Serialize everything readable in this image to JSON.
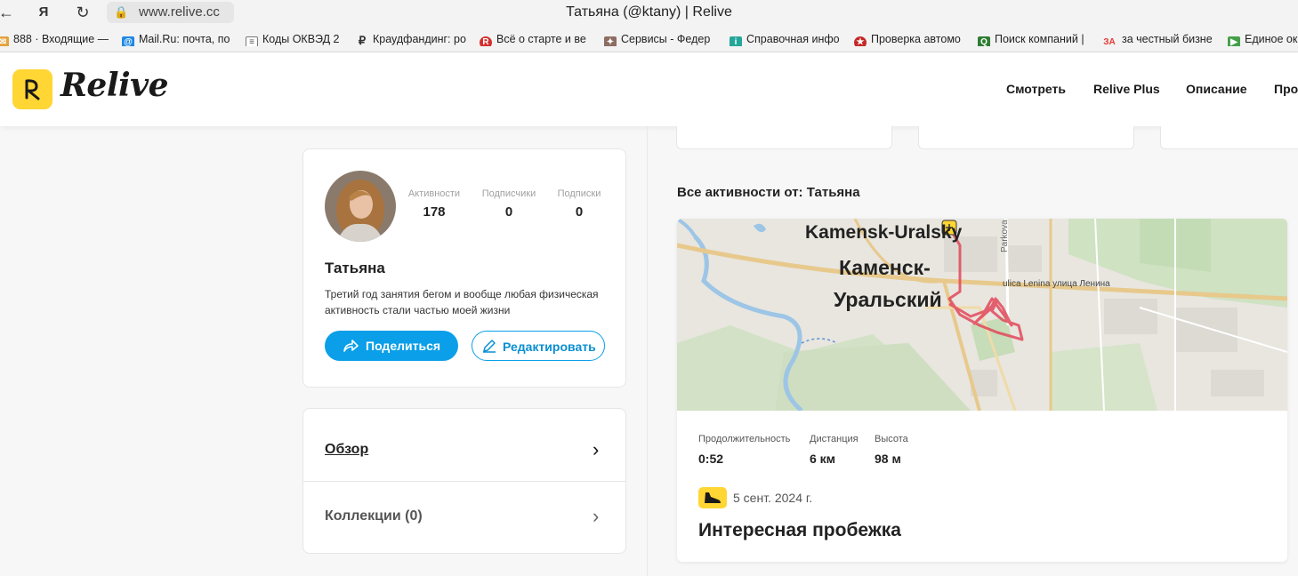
{
  "browser": {
    "url": "www.relive.cc",
    "window_title": "Татьяна (@ktany) | Relive",
    "nav_back": "←",
    "nav_yandex": "Я",
    "nav_reload": "↻",
    "bookmarks": [
      {
        "label": "888 · Входящие —",
        "icon_color": "#e6a23c"
      },
      {
        "label": "Mail.Ru: почта, по",
        "icon_color": "#1e88e5"
      },
      {
        "label": "Коды ОКВЭД 2",
        "icon_color": "#666666"
      },
      {
        "label": "Краудфандинг: ро",
        "icon_color": "#333333"
      },
      {
        "label": "Всё о старте и ве",
        "icon_color": "#d32f2f"
      },
      {
        "label": "Сервисы - Федер",
        "icon_color": "#8d6e63"
      },
      {
        "label": "Справочная инфо",
        "icon_color": "#26a69a"
      },
      {
        "label": "Проверка автомо",
        "icon_color": "#c62828"
      },
      {
        "label": "Поиск компаний |",
        "icon_color": "#2e7d32"
      },
      {
        "label": "за честный бизне",
        "icon_color": "#e53935",
        "icon_text": "ЗА"
      },
      {
        "label": "Единое ок",
        "icon_color": "#43a047"
      }
    ]
  },
  "header": {
    "logo_text": "Relive",
    "logo_glyph": "R",
    "nav": [
      "Смотреть",
      "Relive Plus",
      "Описание",
      "Про"
    ],
    "brand_color": "#ffd633"
  },
  "profile": {
    "stats": [
      {
        "label": "Активности",
        "value": "178"
      },
      {
        "label": "Подписчики",
        "value": "0"
      },
      {
        "label": "Подписки",
        "value": "0"
      }
    ],
    "name": "Татьяна",
    "bio": "Третий год занятия бегом и вообще любая физическая активность стали частью моей жизни",
    "share_label": "Поделиться",
    "edit_label": "Редактировать",
    "accent_color": "#0a9fe8"
  },
  "menu": [
    {
      "label": "Обзор",
      "underlined": true
    },
    {
      "label": "Коллекции (0)",
      "underlined": false
    }
  ],
  "activities": {
    "section_title": "Все активности от: Татьяна",
    "map_labels": {
      "city_latin": "Kamensk-Uralsky",
      "city_ru_line1": "Каменск-",
      "city_ru_line2": "Уральский",
      "street": "ulica Lenina улица Ленина",
      "park": "Parkova"
    },
    "items": [
      {
        "metrics": [
          {
            "label": "Продолжительность",
            "value": "0:52"
          },
          {
            "label": "Дистанция",
            "value": "6 км"
          },
          {
            "label": "Высота",
            "value": "98 м"
          }
        ],
        "date": "5 сент. 2024 г.",
        "title": "Интересная пробежка",
        "activity_icon": "running-shoe-icon"
      }
    ]
  }
}
